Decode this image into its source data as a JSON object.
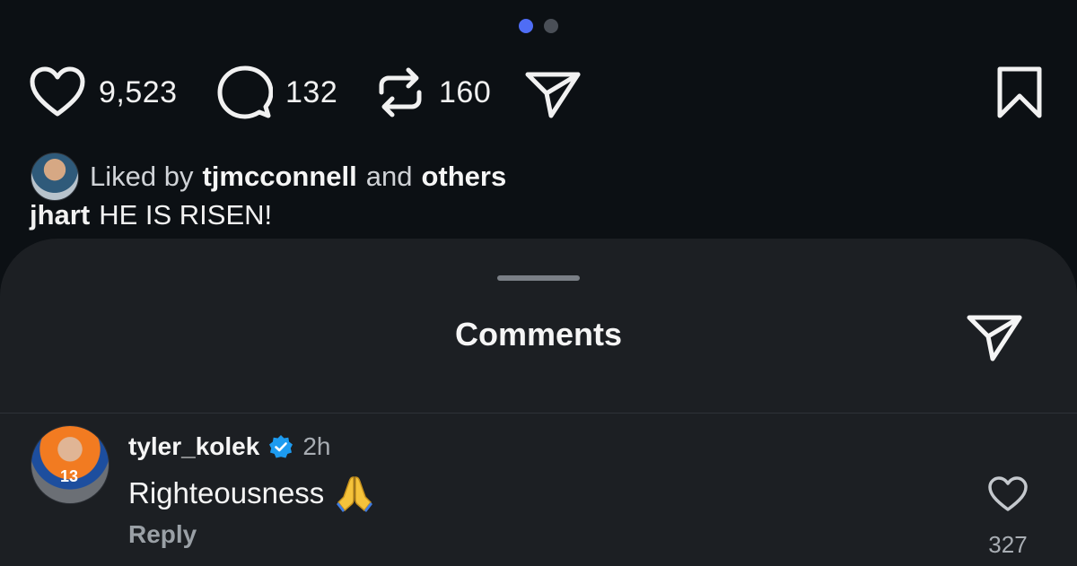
{
  "carousel": {
    "total": 2,
    "active": 1
  },
  "actions": {
    "likes": "9,523",
    "comments": "132",
    "reposts": "160",
    "icons": [
      "heart-icon",
      "comment-icon",
      "repost-icon",
      "share-icon",
      "bookmark-icon"
    ]
  },
  "liked_by": {
    "prefix": "Liked by",
    "user": "tjmcconnell",
    "conjunction": "and",
    "others": "others"
  },
  "caption": {
    "user": "jhart",
    "text": "HE IS RISEN!"
  },
  "comments_sheet": {
    "title": "Comments",
    "items": [
      {
        "username": "tyler_kolek",
        "verified": true,
        "time": "2h",
        "text": "Righteousness",
        "emoji": "folded-hands",
        "reply_label": "Reply",
        "likes": "327"
      }
    ]
  },
  "colors": {
    "background": "#0c1014",
    "sheet": "#1c1f23",
    "accent": "#4f6df5",
    "verified": "#1d9bf0"
  }
}
